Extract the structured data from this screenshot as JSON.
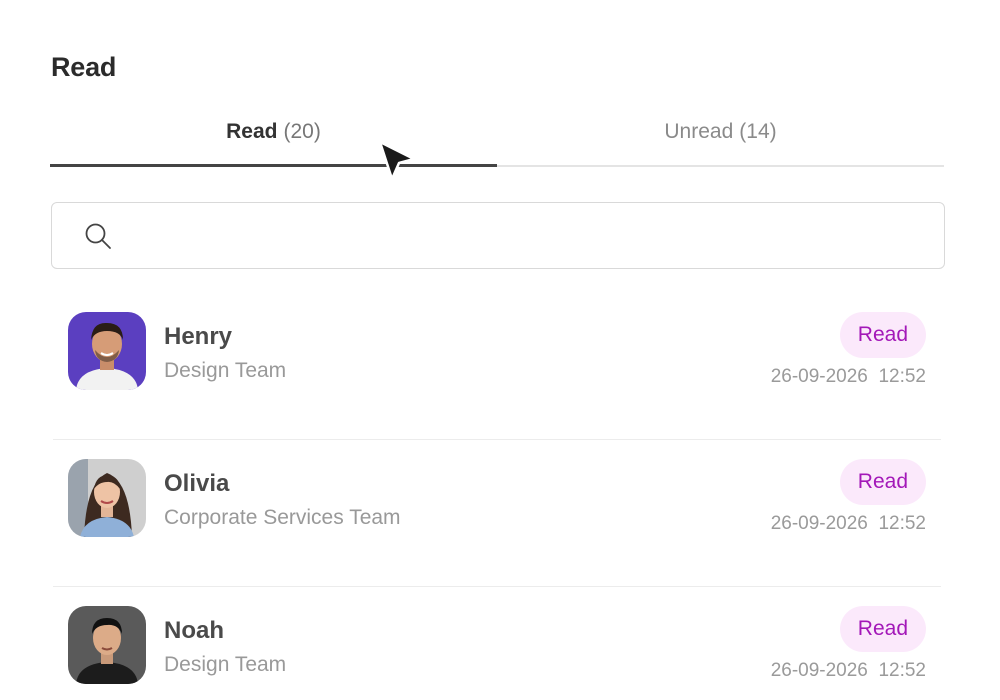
{
  "page": {
    "title": "Read"
  },
  "tabs": [
    {
      "label": "Read",
      "count": "(20)",
      "active": true
    },
    {
      "label": "Unread",
      "count": "(14)",
      "active": false
    }
  ],
  "search": {
    "icon": "search-icon",
    "value": "",
    "placeholder": ""
  },
  "messages": [
    {
      "name": "Henry",
      "team": "Design Team",
      "status": "Read",
      "date": "26-09-2026",
      "time": "12:52",
      "avatar_color": "#5b3fc0"
    },
    {
      "name": "Olivia",
      "team": "Corporate Services Team",
      "status": "Read",
      "date": "26-09-2026",
      "time": "12:52",
      "avatar_color": "#c9c9c9"
    },
    {
      "name": "Noah",
      "team": "Design Team",
      "status": "Read",
      "date": "26-09-2026",
      "time": "12:52",
      "avatar_color": "#5a5a5a"
    }
  ],
  "colors": {
    "badge_bg": "#fbe9fb",
    "badge_text": "#a318b8",
    "active_tab_underline": "#444444"
  }
}
